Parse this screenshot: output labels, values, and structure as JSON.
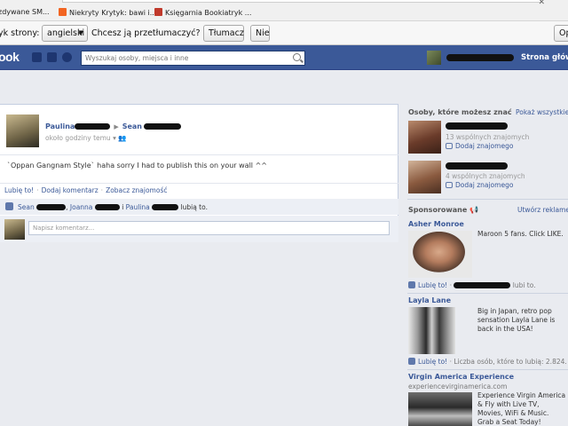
{
  "browser": {
    "bookmarks": [
      {
        "label": "zdywane SM...",
        "icon": "bookmark-icon",
        "color": "#999999"
      },
      {
        "label": "Niekryty Krytyk: bawi i...",
        "icon": "blogger-icon",
        "color": "#f26522"
      },
      {
        "label": "Księgarnia Bookiatryk ...",
        "icon": "bookstore-icon",
        "color": "#c0392b"
      }
    ],
    "translate_bar": {
      "page_language_prefix": "yk strony:",
      "language": "angielski",
      "question": "Chcesz ją przetłumaczyć?",
      "translate_button": "Tłumacz",
      "no_button": "Nie",
      "options_button": "Op"
    }
  },
  "facebook": {
    "logo": "ook",
    "search": {
      "placeholder": "Wyszukaj osoby, miejsca i inne"
    },
    "home_link": "Strona główna",
    "brand_color": "#3b5998"
  },
  "story": {
    "author": "Paulina",
    "target": "Sean",
    "time": "około godziny temu",
    "text": "`Oppan Gangnam Style` haha sorry I had to publish this on your wall ^^",
    "actions": [
      "Lubię to!",
      "Dodaj komentarz",
      "Zobacz znajomość"
    ],
    "likes": {
      "name1": "Sean",
      "name2": "Joanna",
      "name3": "Paulina",
      "and": "i",
      "suffix": "lubią to."
    },
    "comment_placeholder": "Napisz komentarz..."
  },
  "sidebar": {
    "pymk": {
      "heading": "Osoby, które możesz znać",
      "show_all": "Pokaż wszystkie",
      "people": [
        {
          "mutual": "13 wspólnych znajomych",
          "add": "Dodaj znajomego"
        },
        {
          "mutual": "4 wspólnych znajomych",
          "add": "Dodaj znajomego"
        }
      ]
    },
    "sponsored": {
      "heading": "Sponsorowane",
      "create_ad": "Utwórz reklamę",
      "ads": [
        {
          "title": "Asher Monroe",
          "body": "Maroon 5 fans. Click LIKE.",
          "like": "Lubię to!",
          "like_suffix": "lubi to."
        },
        {
          "title": "Layla Lane",
          "body": "Big in Japan, retro pop sensation Layla Lane is back in the USA!",
          "like": "Lubię to!",
          "like_suffix": "Liczba osób, które to lubią: 2.824."
        },
        {
          "title": "Virgin America Experience",
          "url": "experiencevirginamerica.com",
          "body": "Experience Virgin America & Fly with Live TV, Movies, WiFi & Music. Grab a Seat Today!"
        }
      ]
    }
  }
}
